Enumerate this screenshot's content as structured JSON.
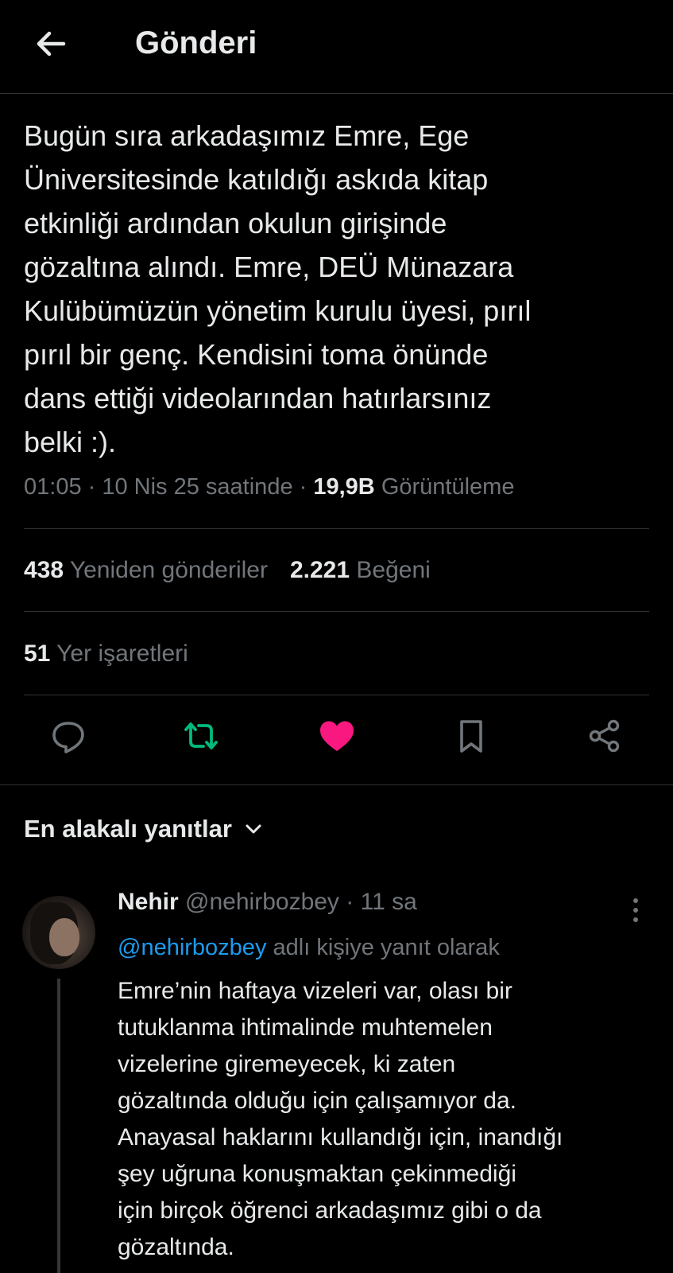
{
  "header": {
    "title": "Gönderi",
    "back_icon": "arrow-left-icon"
  },
  "post": {
    "text_lines": [
      "Bugün sıra arkadaşımız Emre, Ege",
      "Üniversitesinde katıldığı askıda kitap",
      "etkinliği ardından okulun girişinde",
      "gözaltına alındı. Emre, DEÜ Münazara",
      "Kulübümüzün yönetim kurulu üyesi, pırıl",
      "pırıl bir genç. Kendisini toma önünde",
      "dans ettiği videolarından hatırlarsınız",
      "belki :)."
    ],
    "time": "01:05",
    "date": "10 Nis 25 saatinde",
    "views_count": "19,9B",
    "views_label": "Görüntüleme"
  },
  "stats": {
    "reposts_count": "438",
    "reposts_label": "Yeniden gönderiler",
    "likes_count": "2.221",
    "likes_label": "Beğeni",
    "bookmarks_count": "51",
    "bookmarks_label": "Yer işaretleri"
  },
  "actions": {
    "reply_icon": "comment-icon",
    "repost_icon": "repost-icon",
    "like_icon": "heart-icon",
    "bookmark_icon": "bookmark-icon",
    "share_icon": "share-icon"
  },
  "colors": {
    "background": "#000000",
    "text": "#e7e9ea",
    "muted": "#71767b",
    "divider": "#2f3336",
    "link": "#1d9bf0",
    "repost_active": "#00ba7c",
    "like_active": "#f91880"
  },
  "replies": {
    "sort_label": "En alakalı yanıtlar",
    "items": [
      {
        "name": "Nehir",
        "handle": "@nehirbozbey",
        "age": "11 sa",
        "reply_to_handle": "@nehirbozbey",
        "reply_to_suffix": "adlı kişiye yanıt olarak",
        "text_lines": [
          "Emre’nin haftaya vizeleri var, olası bir",
          "tutuklanma ihtimalinde muhtemelen",
          "vizelerine giremeyecek, ki zaten",
          "gözaltında olduğu için çalışamıyor da.",
          "Anayasal haklarını kullandığı için, inandığı",
          "şey uğruna konuşmaktan çekinmediği",
          "için birçok öğrenci arkadaşımız gibi o da",
          "gözaltında."
        ]
      }
    ]
  }
}
